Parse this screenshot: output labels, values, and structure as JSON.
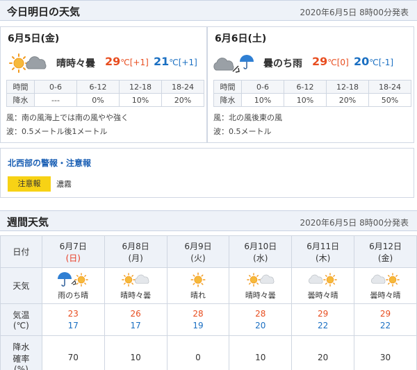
{
  "today_section": {
    "title": "今日明日の天気",
    "issued": "2020年6月5日 8時00分発表",
    "days": [
      {
        "date_label": "6月5日(金)",
        "weather_icon": "sun-and-cloud-icon",
        "telop": "晴時々曇",
        "high": "29",
        "high_diff": "[+1]",
        "low": "21",
        "low_diff": "[+1]",
        "unit": "℃",
        "rain_header": [
          "時間",
          "0-6",
          "6-12",
          "12-18",
          "18-24"
        ],
        "rain_values": [
          "降水",
          "---",
          "0%",
          "10%",
          "20%"
        ],
        "wind": "風：南の風海上では南の風やや強く",
        "wave": "波：0.5メートル後1メートル"
      },
      {
        "date_label": "6月6日(土)",
        "weather_icon": "cloud-then-rain-icon",
        "telop": "曇のち雨",
        "high": "29",
        "high_diff": "[0]",
        "low": "20",
        "low_diff": "[-1]",
        "unit": "℃",
        "rain_header": [
          "時間",
          "0-6",
          "6-12",
          "12-18",
          "18-24"
        ],
        "rain_values": [
          "降水",
          "10%",
          "10%",
          "20%",
          "50%"
        ],
        "wind": "風：北の風後東の風",
        "wave": "波：0.5メートル"
      }
    ]
  },
  "warnings": {
    "title": "北西部の警報・注意報",
    "badge": "注意報",
    "text": "濃霧"
  },
  "week_section": {
    "title": "週間天気",
    "issued": "2020年6月5日 8時00分発表",
    "row_labels": {
      "date": "日付",
      "weather": "天気",
      "temp_1": "気温",
      "temp_2": "(℃)",
      "rain_1": "降水",
      "rain_2": "確率",
      "rain_3": "(%)"
    },
    "days": [
      {
        "date": "6月7日",
        "dow": "(日)",
        "sunday": true,
        "icon": "rain-then-sun-icon",
        "telop": "雨のち晴",
        "high": "23",
        "low": "17",
        "pop": "70"
      },
      {
        "date": "6月8日",
        "dow": "(月)",
        "sunday": false,
        "icon": "sun-and-cloud-icon",
        "telop": "晴時々曇",
        "high": "26",
        "low": "17",
        "pop": "10"
      },
      {
        "date": "6月9日",
        "dow": "(火)",
        "sunday": false,
        "icon": "sun-icon",
        "telop": "晴れ",
        "high": "28",
        "low": "19",
        "pop": "0"
      },
      {
        "date": "6月10日",
        "dow": "(水)",
        "sunday": false,
        "icon": "sun-and-cloud-icon",
        "telop": "晴時々曇",
        "high": "28",
        "low": "20",
        "pop": "10"
      },
      {
        "date": "6月11日",
        "dow": "(木)",
        "sunday": false,
        "icon": "cloud-and-sun-icon",
        "telop": "曇時々晴",
        "high": "29",
        "low": "22",
        "pop": "20"
      },
      {
        "date": "6月12日",
        "dow": "(金)",
        "sunday": false,
        "icon": "cloud-and-sun-icon",
        "telop": "曇時々晴",
        "high": "29",
        "low": "22",
        "pop": "30"
      }
    ]
  },
  "colors": {
    "high_temp": "#e84d1f",
    "low_temp": "#1a6fc2",
    "sunday": "#e83820",
    "warning_badge": "#f7d215",
    "header_bg": "#eef2f8"
  }
}
